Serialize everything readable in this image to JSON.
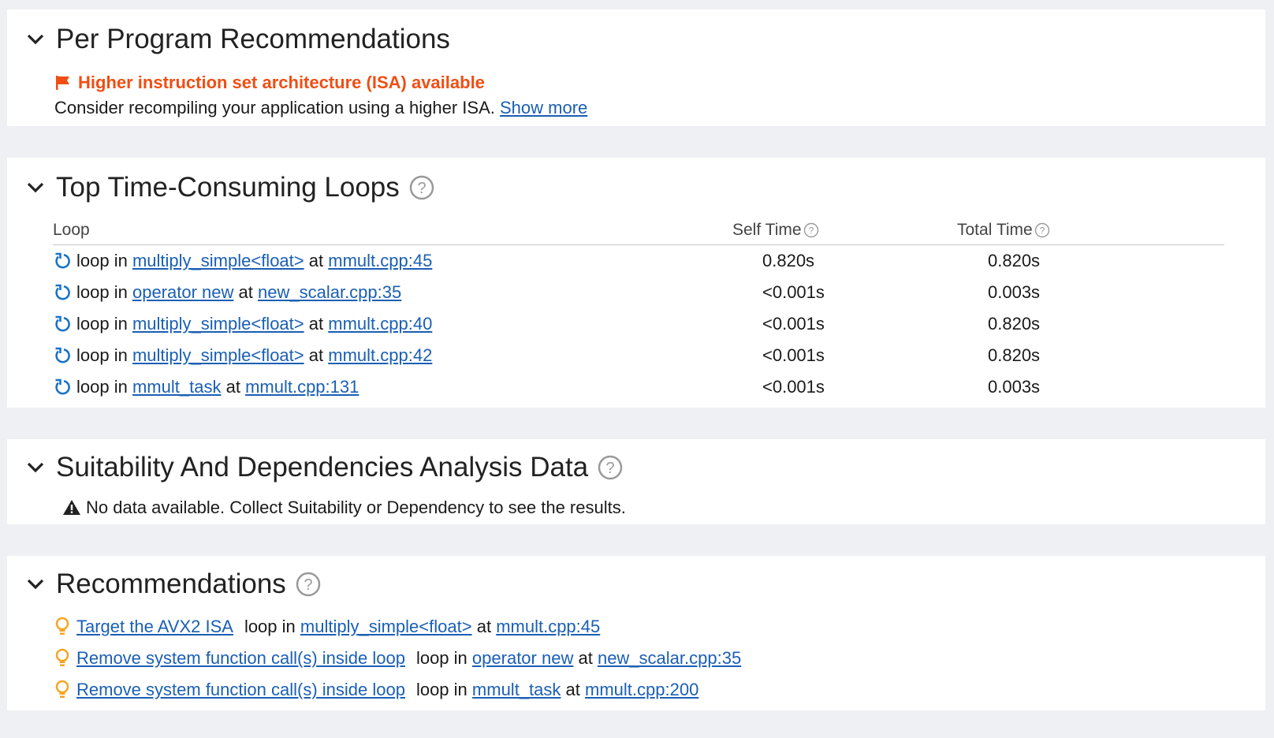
{
  "panels": {
    "per_program": {
      "title": "Per Program Recommendations",
      "warning_title": "Higher instruction set architecture (ISA) available",
      "description": "Consider recompiling your application using a higher ISA.",
      "show_more": "Show more"
    },
    "top_loops": {
      "title": "Top Time-Consuming Loops",
      "columns": {
        "loop": "Loop",
        "self_time": "Self Time",
        "total_time": "Total Time"
      },
      "rows": [
        {
          "prefix": "loop in",
          "function": "multiply_simple<float>",
          "at": "at",
          "location": "mmult.cpp:45",
          "self": "0.820s",
          "total": "0.820s"
        },
        {
          "prefix": "loop in",
          "function": "operator new",
          "at": "at",
          "location": "new_scalar.cpp:35",
          "self": "<0.001s",
          "total": "0.003s"
        },
        {
          "prefix": "loop in",
          "function": "multiply_simple<float>",
          "at": "at",
          "location": "mmult.cpp:40",
          "self": "<0.001s",
          "total": "0.820s"
        },
        {
          "prefix": "loop in",
          "function": "multiply_simple<float>",
          "at": "at",
          "location": "mmult.cpp:42",
          "self": "<0.001s",
          "total": "0.820s"
        },
        {
          "prefix": "loop in",
          "function": "mmult_task",
          "at": "at",
          "location": "mmult.cpp:131",
          "self": "<0.001s",
          "total": "0.003s"
        }
      ]
    },
    "suitability": {
      "title": "Suitability And Dependencies Analysis Data",
      "message": "No data available. Collect Suitability or Dependency to see the results."
    },
    "recommendations": {
      "title": "Recommendations",
      "items": [
        {
          "recommendation": "Target the AVX2 ISA",
          "prefix": "loop in",
          "function": "multiply_simple<float>",
          "at": "at",
          "location": "mmult.cpp:45"
        },
        {
          "recommendation": "Remove system function call(s) inside loop",
          "prefix": "loop in",
          "function": "operator new",
          "at": "at",
          "location": "new_scalar.cpp:35"
        },
        {
          "recommendation": "Remove system function call(s) inside loop",
          "prefix": "loop in",
          "function": "mmult_task",
          "at": "at",
          "location": "mmult.cpp:200"
        }
      ]
    }
  },
  "colors": {
    "background": "#eef0f3",
    "panel": "#ffffff",
    "link": "#1a5fb4",
    "warning_orange": "#f04e14",
    "loop_icon_blue": "#1a73c8",
    "bulb_orange": "#f5a623"
  },
  "icons": {
    "collapse": "chevron-down-icon",
    "help": "help-circle-icon",
    "warning_flag": "flag-icon",
    "loop": "loop-refresh-icon",
    "no_data": "warning-triangle-icon",
    "recommendation": "lightbulb-icon"
  }
}
